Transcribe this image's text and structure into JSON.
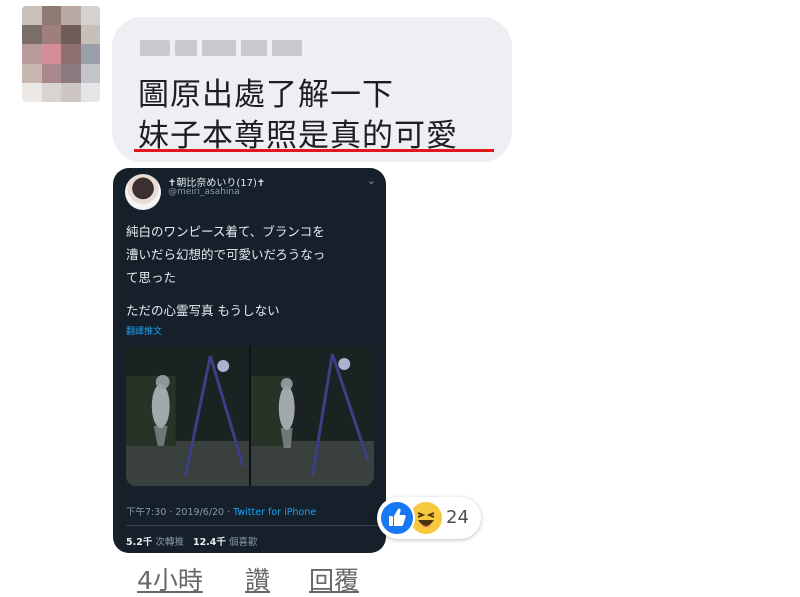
{
  "comment": {
    "line1": "圖原出處了解一下",
    "line2": "妹子本尊照是真的可愛",
    "highlight_color": "#e0191f"
  },
  "tweet": {
    "name": "✝朝比奈めいり(17)✝",
    "handle": "@meiri_asahina",
    "body": [
      "純白のワンピース着て、ブランコを",
      "漕いだら幻想的で可愛いだろうなっ",
      "て思った"
    ],
    "body2": "ただの心霊写真 もうしない",
    "translate": "翻譯推文",
    "time": "下午7:30 · 2019/6/20 · ",
    "source": "Twitter for iPhone",
    "retweets_count": "5.2千",
    "retweets_label": "次轉推",
    "likes_count": "12.4千",
    "likes_label": "個喜歡"
  },
  "reactions": {
    "icons": [
      "like-icon",
      "haha-icon"
    ],
    "count": "24"
  },
  "actions": {
    "time": "4小時",
    "like": "讚",
    "reply": "回覆"
  }
}
